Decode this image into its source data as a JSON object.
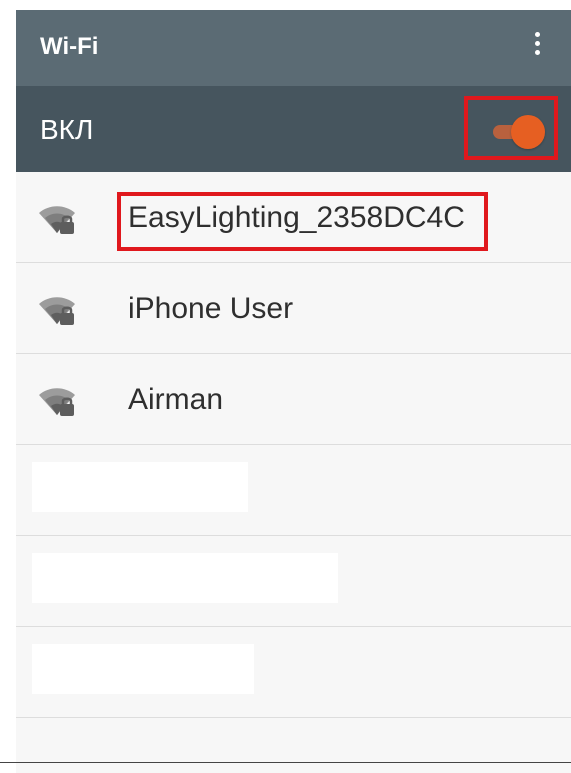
{
  "appbar": {
    "title": "Wi-Fi",
    "menu_icon": "more-vert-icon"
  },
  "wifi_switch": {
    "label": "ВКЛ",
    "state": "on",
    "thumb_color": "#e65f22",
    "track_color": "#b9613e"
  },
  "networks": [
    {
      "name": "EasyLighting_2358DC4C",
      "icon": "wifi-lock-icon"
    },
    {
      "name": "iPhone User",
      "icon": "wifi-lock-icon"
    },
    {
      "name": "Airman",
      "icon": "wifi-lock-icon"
    }
  ],
  "colors": {
    "appbar_bg": "#5b6b74",
    "switchbar_bg": "#46555e",
    "highlight": "#e0181d",
    "list_bg": "#f7f7f7"
  }
}
